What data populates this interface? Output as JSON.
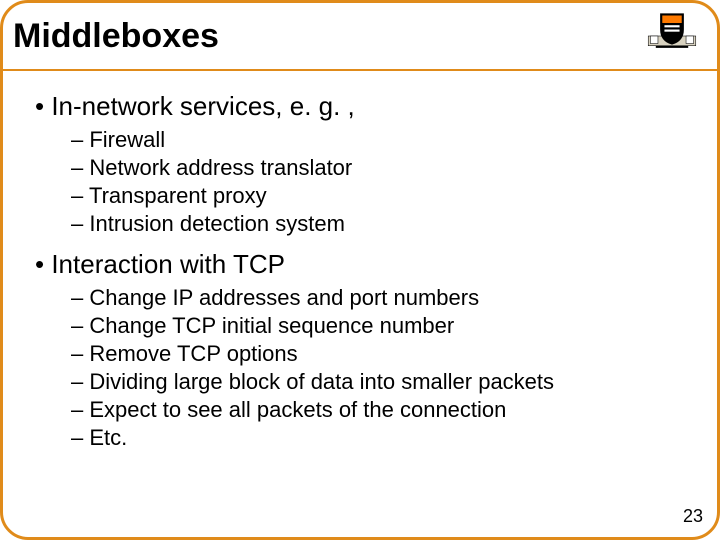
{
  "title": "Middleboxes",
  "sections": [
    {
      "heading": "In-network services, e. g. ,",
      "items": [
        "Firewall",
        "Network address translator",
        "Transparent proxy",
        "Intrusion detection system"
      ]
    },
    {
      "heading": "Interaction with TCP",
      "items": [
        "Change IP addresses and port numbers",
        "Change TCP initial sequence number",
        "Remove TCP options",
        "Dividing large block of data into smaller packets",
        "Expect to see all packets of the connection",
        "Etc."
      ]
    }
  ],
  "page_number": "23",
  "crest_alt": "Princeton shield"
}
